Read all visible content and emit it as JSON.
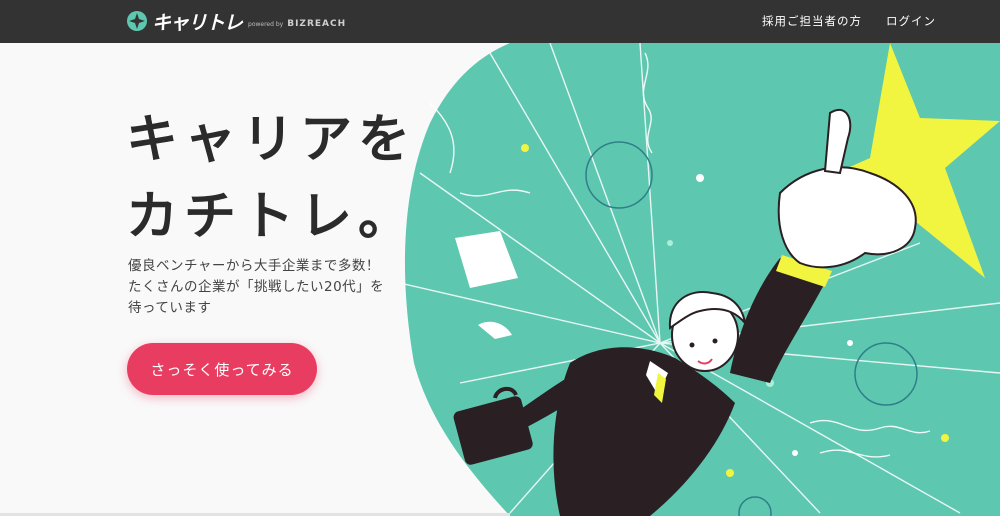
{
  "header": {
    "logo_text": "キャリトレ",
    "powered_by": "powered by",
    "brand": "BIZREACH",
    "nav": [
      {
        "label": "採用ご担当者の方"
      },
      {
        "label": "ログイン"
      }
    ]
  },
  "hero": {
    "headline": [
      "キャリアを",
      "カチトレ。"
    ],
    "subtext": [
      "優良ベンチャーから大手企業まで多数！",
      "たくさんの企業が「挑戦したい20代」を",
      "待っています"
    ],
    "cta_label": "さっそく使ってみる"
  },
  "colors": {
    "topbar": "#333333",
    "accent": "#e83d61",
    "teal": "#5ec7b0",
    "star": "#f2f53f",
    "suit": "#2a1f22"
  }
}
